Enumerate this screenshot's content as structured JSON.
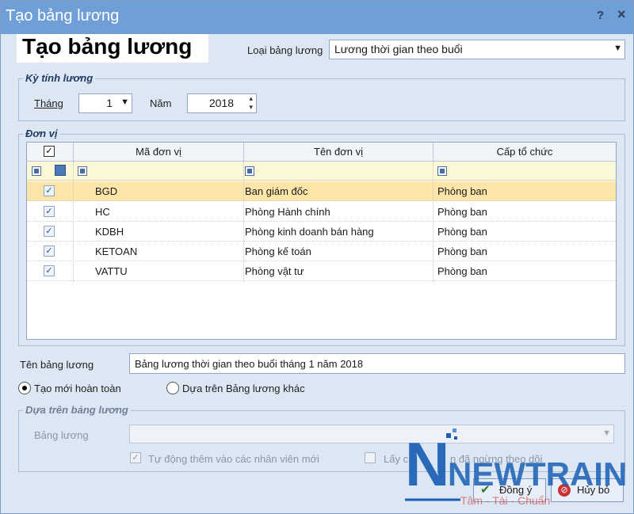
{
  "window": {
    "title": "Tạo bảng lương",
    "help_glyph": "?",
    "close_glyph": "×"
  },
  "header": {
    "big_title": "Tạo bảng lương"
  },
  "payroll_type": {
    "label": "Loại bảng lương",
    "value": "Lương thời gian theo buổi"
  },
  "period": {
    "group_title": "Kỳ tính lương",
    "month_label": "Tháng",
    "month_value": "1",
    "year_label": "Năm",
    "year_value": "2018"
  },
  "units": {
    "group_title": "Đơn vị",
    "columns": [
      "Mã đơn vị",
      "Tên đơn vị",
      "Cấp tổ chức"
    ],
    "rows": [
      {
        "code": "BGD",
        "name": "Ban giám đốc",
        "level": "Phòng ban",
        "checked": true,
        "selected": true
      },
      {
        "code": "HC",
        "name": "Phòng Hành chính",
        "level": "Phòng ban",
        "checked": true,
        "selected": false
      },
      {
        "code": "KDBH",
        "name": "Phòng kinh doanh bán hàng",
        "level": "Phòng ban",
        "checked": true,
        "selected": false
      },
      {
        "code": "KETOAN",
        "name": "Phòng kế toán",
        "level": "Phòng ban",
        "checked": true,
        "selected": false
      },
      {
        "code": "VATTU",
        "name": "Phòng vật tư",
        "level": "Phòng ban",
        "checked": true,
        "selected": false
      }
    ]
  },
  "payroll_name": {
    "label": "Tên bảng lương",
    "value": "Bảng lương thời gian theo buổi tháng 1 năm 2018"
  },
  "mode": {
    "new_label": "Tạo mới hoàn toàn",
    "based_label": "Dựa trên Bảng lương khác",
    "selected": "new"
  },
  "based_on": {
    "group_title": "Dựa trên bảng lương",
    "payroll_label": "Bảng lương",
    "auto_add_label": "Tự động thêm vào các nhân viên mới",
    "take_label_visible": "Lấy c",
    "take_label_tail": "n đã ngừng theo dõi"
  },
  "buttons": {
    "ok": "Đồng ý",
    "cancel": "Hủy bỏ"
  },
  "watermark": {
    "brand": "NEWTRAIN",
    "slogan": "Tâm - Tài - Chuẩn"
  },
  "colors": {
    "titlebar": "#6f9fd6",
    "dialog_bg": "#dde7f4",
    "selected_row": "#fbe5a8",
    "filter_row": "#fbf8d8",
    "logo_blue": "#1a5fb4",
    "logo_red": "#d0342c"
  }
}
